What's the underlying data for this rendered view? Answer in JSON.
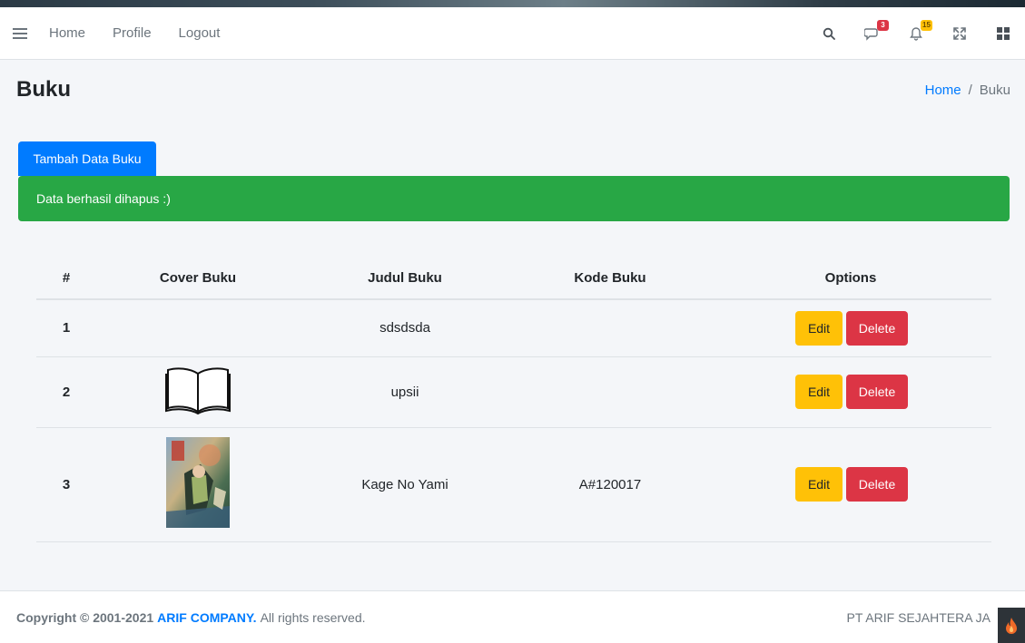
{
  "navbar": {
    "links": [
      "Home",
      "Profile",
      "Logout"
    ],
    "messages_badge": "3",
    "notifications_badge": "15"
  },
  "header": {
    "title": "Buku",
    "breadcrumb": {
      "home": "Home",
      "separator": "/",
      "current": "Buku"
    }
  },
  "actions": {
    "add_label": "Tambah Data Buku"
  },
  "alert": {
    "message": "Data berhasil dihapus :)"
  },
  "table": {
    "headers": [
      "#",
      "Cover Buku",
      "Judul Buku",
      "Kode Buku",
      "Options"
    ],
    "rows": [
      {
        "num": "1",
        "cover": "none",
        "judul": "sdsdsda",
        "kode": ""
      },
      {
        "num": "2",
        "cover": "open-book-icon",
        "judul": "upsii",
        "kode": ""
      },
      {
        "num": "3",
        "cover": "manga-cover",
        "judul": "Kage No Yami",
        "kode": "A#120017"
      }
    ],
    "edit_label": "Edit",
    "delete_label": "Delete"
  },
  "footer": {
    "copyright": "Copyright © 2001-2021",
    "brand": "ARIF COMPANY.",
    "rest": "All rights reserved.",
    "right": "PT ARIF SEJAHTERA JA"
  },
  "colors": {
    "primary": "#007bff",
    "success": "#28a745",
    "warning": "#ffc107",
    "danger": "#dc3545"
  }
}
